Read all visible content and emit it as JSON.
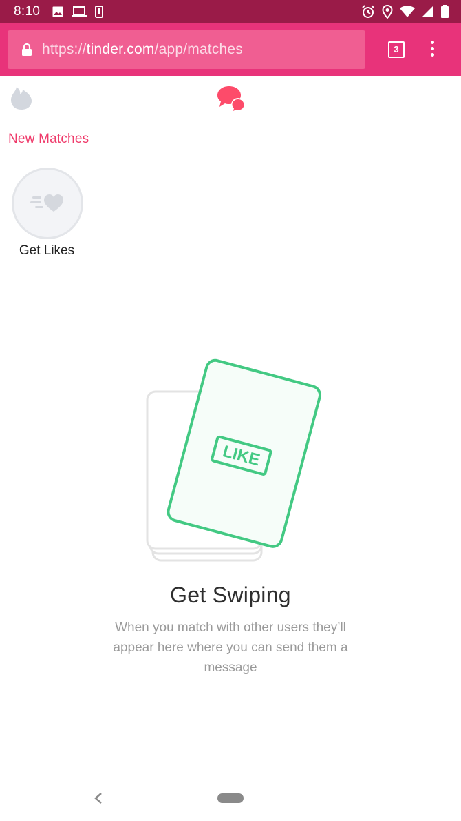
{
  "status_bar": {
    "time": "8:10",
    "left_icons": [
      "image-icon",
      "laptop-icon",
      "phone-icon"
    ],
    "right_icons": [
      "alarm-icon",
      "location-icon",
      "wifi-icon",
      "signal-icon",
      "battery-icon"
    ],
    "background": "#9a1b48"
  },
  "browser": {
    "url_scheme": "https://",
    "url_host": "tinder.com",
    "url_path": "/app/matches",
    "tab_count": "3",
    "toolbar_color": "#e8337a"
  },
  "app_nav": {
    "left_icon": "flame-icon",
    "center_icon": "chat-bubbles-icon",
    "accent": "#fd4b6a"
  },
  "new_matches": {
    "title": "New Matches",
    "items": [
      {
        "label": "Get Likes",
        "icon": "heart-boost-icon"
      }
    ]
  },
  "empty_state": {
    "card_stamp": "LIKE",
    "card_color": "#43c983",
    "title": "Get Swiping",
    "description": "When you match with other users they’ll appear here where you can send them a message"
  },
  "android_nav": {
    "back": "back-icon",
    "home": "home-pill"
  }
}
